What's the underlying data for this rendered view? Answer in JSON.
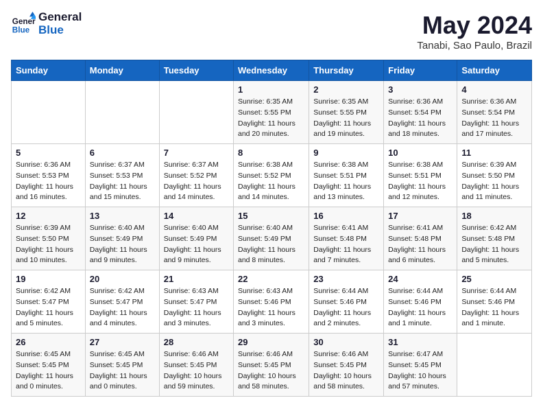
{
  "header": {
    "logo_line1": "General",
    "logo_line2": "Blue",
    "month": "May 2024",
    "location": "Tanabi, Sao Paulo, Brazil"
  },
  "weekdays": [
    "Sunday",
    "Monday",
    "Tuesday",
    "Wednesday",
    "Thursday",
    "Friday",
    "Saturday"
  ],
  "weeks": [
    [
      {
        "day": "",
        "info": ""
      },
      {
        "day": "",
        "info": ""
      },
      {
        "day": "",
        "info": ""
      },
      {
        "day": "1",
        "info": "Sunrise: 6:35 AM\nSunset: 5:55 PM\nDaylight: 11 hours\nand 20 minutes."
      },
      {
        "day": "2",
        "info": "Sunrise: 6:35 AM\nSunset: 5:55 PM\nDaylight: 11 hours\nand 19 minutes."
      },
      {
        "day": "3",
        "info": "Sunrise: 6:36 AM\nSunset: 5:54 PM\nDaylight: 11 hours\nand 18 minutes."
      },
      {
        "day": "4",
        "info": "Sunrise: 6:36 AM\nSunset: 5:54 PM\nDaylight: 11 hours\nand 17 minutes."
      }
    ],
    [
      {
        "day": "5",
        "info": "Sunrise: 6:36 AM\nSunset: 5:53 PM\nDaylight: 11 hours\nand 16 minutes."
      },
      {
        "day": "6",
        "info": "Sunrise: 6:37 AM\nSunset: 5:53 PM\nDaylight: 11 hours\nand 15 minutes."
      },
      {
        "day": "7",
        "info": "Sunrise: 6:37 AM\nSunset: 5:52 PM\nDaylight: 11 hours\nand 14 minutes."
      },
      {
        "day": "8",
        "info": "Sunrise: 6:38 AM\nSunset: 5:52 PM\nDaylight: 11 hours\nand 14 minutes."
      },
      {
        "day": "9",
        "info": "Sunrise: 6:38 AM\nSunset: 5:51 PM\nDaylight: 11 hours\nand 13 minutes."
      },
      {
        "day": "10",
        "info": "Sunrise: 6:38 AM\nSunset: 5:51 PM\nDaylight: 11 hours\nand 12 minutes."
      },
      {
        "day": "11",
        "info": "Sunrise: 6:39 AM\nSunset: 5:50 PM\nDaylight: 11 hours\nand 11 minutes."
      }
    ],
    [
      {
        "day": "12",
        "info": "Sunrise: 6:39 AM\nSunset: 5:50 PM\nDaylight: 11 hours\nand 10 minutes."
      },
      {
        "day": "13",
        "info": "Sunrise: 6:40 AM\nSunset: 5:49 PM\nDaylight: 11 hours\nand 9 minutes."
      },
      {
        "day": "14",
        "info": "Sunrise: 6:40 AM\nSunset: 5:49 PM\nDaylight: 11 hours\nand 9 minutes."
      },
      {
        "day": "15",
        "info": "Sunrise: 6:40 AM\nSunset: 5:49 PM\nDaylight: 11 hours\nand 8 minutes."
      },
      {
        "day": "16",
        "info": "Sunrise: 6:41 AM\nSunset: 5:48 PM\nDaylight: 11 hours\nand 7 minutes."
      },
      {
        "day": "17",
        "info": "Sunrise: 6:41 AM\nSunset: 5:48 PM\nDaylight: 11 hours\nand 6 minutes."
      },
      {
        "day": "18",
        "info": "Sunrise: 6:42 AM\nSunset: 5:48 PM\nDaylight: 11 hours\nand 5 minutes."
      }
    ],
    [
      {
        "day": "19",
        "info": "Sunrise: 6:42 AM\nSunset: 5:47 PM\nDaylight: 11 hours\nand 5 minutes."
      },
      {
        "day": "20",
        "info": "Sunrise: 6:42 AM\nSunset: 5:47 PM\nDaylight: 11 hours\nand 4 minutes."
      },
      {
        "day": "21",
        "info": "Sunrise: 6:43 AM\nSunset: 5:47 PM\nDaylight: 11 hours\nand 3 minutes."
      },
      {
        "day": "22",
        "info": "Sunrise: 6:43 AM\nSunset: 5:46 PM\nDaylight: 11 hours\nand 3 minutes."
      },
      {
        "day": "23",
        "info": "Sunrise: 6:44 AM\nSunset: 5:46 PM\nDaylight: 11 hours\nand 2 minutes."
      },
      {
        "day": "24",
        "info": "Sunrise: 6:44 AM\nSunset: 5:46 PM\nDaylight: 11 hours\nand 1 minute."
      },
      {
        "day": "25",
        "info": "Sunrise: 6:44 AM\nSunset: 5:46 PM\nDaylight: 11 hours\nand 1 minute."
      }
    ],
    [
      {
        "day": "26",
        "info": "Sunrise: 6:45 AM\nSunset: 5:45 PM\nDaylight: 11 hours\nand 0 minutes."
      },
      {
        "day": "27",
        "info": "Sunrise: 6:45 AM\nSunset: 5:45 PM\nDaylight: 11 hours\nand 0 minutes."
      },
      {
        "day": "28",
        "info": "Sunrise: 6:46 AM\nSunset: 5:45 PM\nDaylight: 10 hours\nand 59 minutes."
      },
      {
        "day": "29",
        "info": "Sunrise: 6:46 AM\nSunset: 5:45 PM\nDaylight: 10 hours\nand 58 minutes."
      },
      {
        "day": "30",
        "info": "Sunrise: 6:46 AM\nSunset: 5:45 PM\nDaylight: 10 hours\nand 58 minutes."
      },
      {
        "day": "31",
        "info": "Sunrise: 6:47 AM\nSunset: 5:45 PM\nDaylight: 10 hours\nand 57 minutes."
      },
      {
        "day": "",
        "info": ""
      }
    ]
  ]
}
